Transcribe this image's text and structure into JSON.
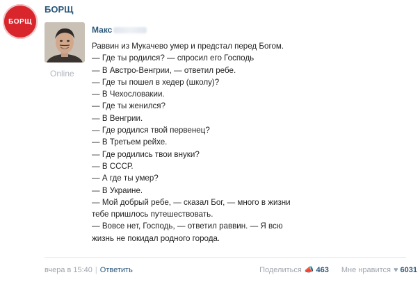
{
  "group": {
    "logo_text": "БОРЩ",
    "name": "БОРЩ"
  },
  "post": {
    "author_visible": "Макс",
    "status": "Online",
    "lines": [
      "Раввин из Мукачево умер и предстал перед Богом.",
      "— Где ты родился? — спросил его Господь",
      "— В Австро-Венгрии, — ответил ребе.",
      "— Где ты пошел в хедер (школу)?",
      "— В Чехословакии.",
      "— Где ты женился?",
      "— В Венгрии.",
      "— Где родился твой первенец?",
      "— В Третьем рейхе.",
      "— Где родились твои внуки?",
      "— В СССР.",
      "— А где ты умер?",
      "— В Украине.",
      "— Мой добрый ребе, — сказал Бог, — много в жизни",
      "тебе пришлось путешествовать.",
      "— Вовсе нет, Господь, — ответил раввин. — Я всю",
      "жизнь не покидал родного города."
    ]
  },
  "footer": {
    "timestamp": "вчера в 15:40",
    "separator": "|",
    "reply_label": "Ответить",
    "share_label": "Поделиться",
    "share_icon": "megaphone-icon",
    "share_count": "463",
    "like_label": "Мне нравится",
    "like_icon": "heart-icon",
    "like_count": "6031"
  },
  "colors": {
    "brand_red": "#d8262c",
    "link_blue": "#2b587a",
    "muted_gray": "#a0a6ad"
  }
}
